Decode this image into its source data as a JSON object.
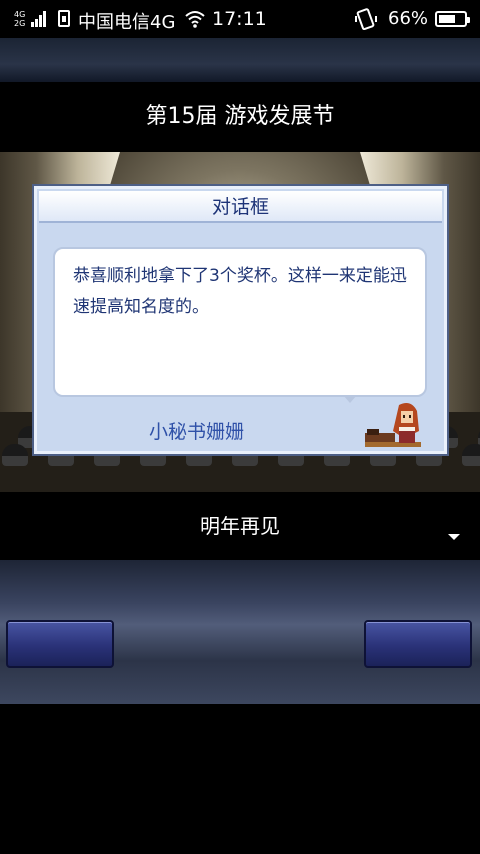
{
  "status_bar": {
    "net_top": "4G",
    "net_bottom": "2G",
    "carrier": "中国电信4G",
    "time": "17:11",
    "battery_pct": "66%",
    "battery_level": 0.66
  },
  "event": {
    "title": "第15届 游戏发展节"
  },
  "dialog": {
    "header": "对话框",
    "message": "恭喜顺利地拿下了3个奖杯。这样一来定能迅速提高知名度的。",
    "speaker": "小秘书姗姗"
  },
  "caption": {
    "text": "明年再见"
  },
  "colors": {
    "dialog_text": "#1f3574",
    "speaker_text": "#2f51a8",
    "button_blue": "#2a3278"
  }
}
